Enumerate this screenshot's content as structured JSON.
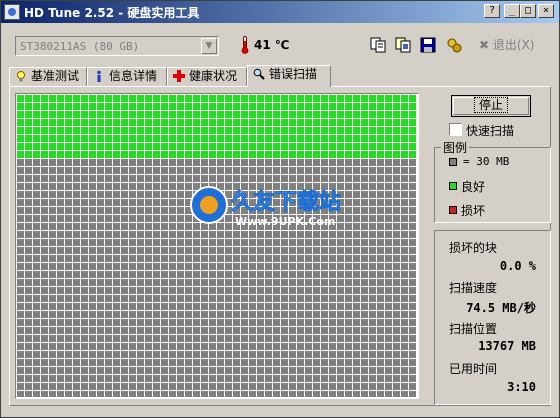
{
  "window": {
    "title": "HD Tune 2.52 - 硬盘实用工具"
  },
  "titlebar_buttons": {
    "help": "?",
    "minimize": "_",
    "maximize": "□",
    "close": "×"
  },
  "toolbar": {
    "drive": "ST380211AS (80 GB)",
    "temperature": "41 ℃",
    "exit_label": "退出(X)",
    "icons": [
      "copy-icon",
      "copy-options-icon",
      "save-icon",
      "options-icon"
    ]
  },
  "tabs": [
    {
      "label": "基准测试",
      "icon": "bulb-icon"
    },
    {
      "label": "信息详情",
      "icon": "info-icon"
    },
    {
      "label": "健康状况",
      "icon": "health-cross-icon"
    },
    {
      "label": "错误扫描",
      "icon": "magnifier-icon",
      "active": true
    }
  ],
  "scan": {
    "stop_label": "停止",
    "quick_scan_label": "快速扫描",
    "quick_scan_checked": false,
    "grid_columns": 50,
    "grid_rows": 38,
    "scanned_rows": 8,
    "colors": {
      "good": "#22dd22",
      "unscanned": "#808080",
      "damaged": "#cc2222"
    }
  },
  "legend": {
    "title": "图例",
    "block_size": "= 30 MB",
    "good_label": "良好",
    "damaged_label": "损坏"
  },
  "stats": {
    "damaged_blocks_label": "损坏的块",
    "damaged_blocks_value": "0.0 %",
    "speed_label": "扫描速度",
    "speed_value": "74.5 MB/秒",
    "position_label": "扫描位置",
    "position_value": "13767 MB",
    "elapsed_label": "已用时间",
    "elapsed_value": "3:10"
  },
  "watermark": {
    "brand": "久友下载站",
    "url": "Www.9UPK.Com"
  }
}
